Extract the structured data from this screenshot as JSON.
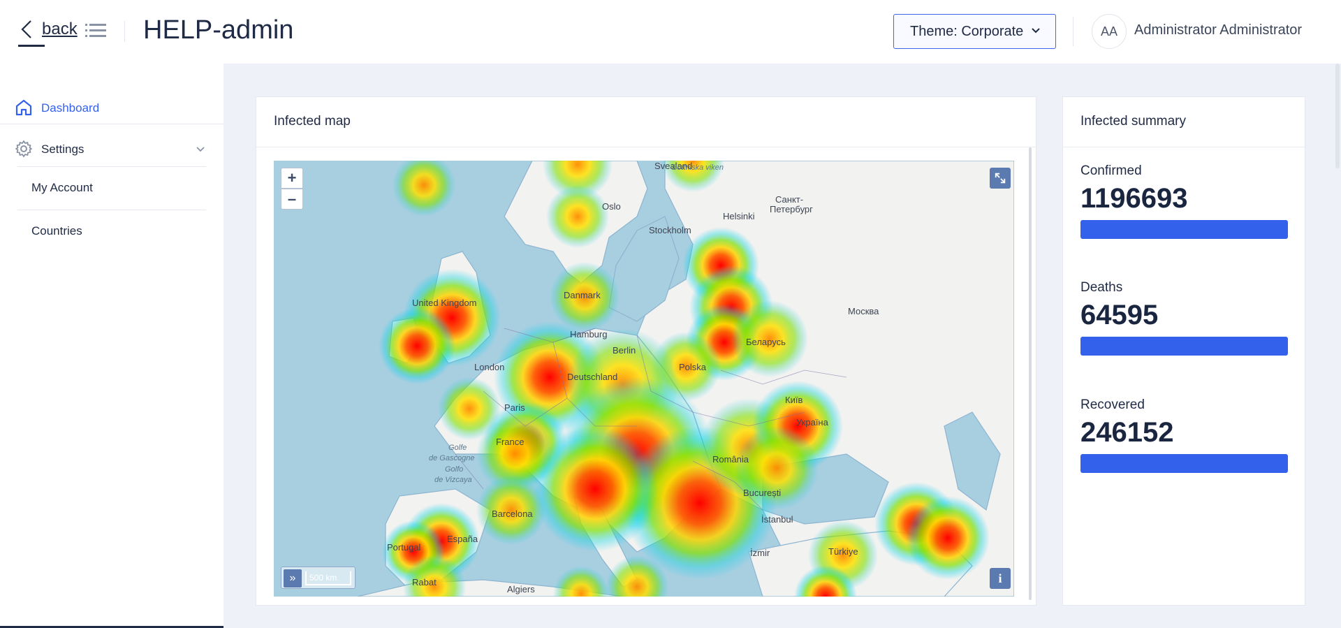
{
  "header": {
    "back_label": "back",
    "app_title": "HELP-admin",
    "theme_select": "Theme: Corporate",
    "avatar_initials": "AA",
    "user_name": "Administrator Administrator"
  },
  "sidebar": {
    "items": [
      {
        "label": "Dashboard",
        "icon": "home-icon",
        "active": true
      },
      {
        "label": "Settings",
        "icon": "gear-icon",
        "expanded": true
      }
    ],
    "sub_items": [
      {
        "label": "My Account"
      },
      {
        "label": "Countries"
      }
    ]
  },
  "map_card": {
    "title": "Infected map",
    "zoom_in": "+",
    "zoom_out": "–",
    "scale": "500 km",
    "scale_toggle": "»",
    "info": "i",
    "labels": [
      {
        "text": "Oslo",
        "kind": "city"
      },
      {
        "text": "Stockholm",
        "kind": "city"
      },
      {
        "text": "Helsinki",
        "kind": "city"
      },
      {
        "text": "Санкт-",
        "kind": "city"
      },
      {
        "text": "Петербург",
        "kind": "city"
      },
      {
        "text": "Москва",
        "kind": "city"
      },
      {
        "text": "United Kingdom",
        "kind": "country"
      },
      {
        "text": "Danmark",
        "kind": "country"
      },
      {
        "text": "Hamburg",
        "kind": "city"
      },
      {
        "text": "Berlin",
        "kind": "city"
      },
      {
        "text": "London",
        "kind": "city"
      },
      {
        "text": "Deutschland",
        "kind": "country"
      },
      {
        "text": "Polska",
        "kind": "country"
      },
      {
        "text": "Беларусь",
        "kind": "country"
      },
      {
        "text": "Paris",
        "kind": "city"
      },
      {
        "text": "France",
        "kind": "country"
      },
      {
        "text": "Київ",
        "kind": "city"
      },
      {
        "text": "Україна",
        "kind": "country"
      },
      {
        "text": "Golfe",
        "kind": "sea"
      },
      {
        "text": "de Gascogne",
        "kind": "sea"
      },
      {
        "text": "Golfo",
        "kind": "sea"
      },
      {
        "text": "de Vizcaya",
        "kind": "sea"
      },
      {
        "text": "Barcelona",
        "kind": "city"
      },
      {
        "text": "España",
        "kind": "country"
      },
      {
        "text": "Portugal",
        "kind": "country"
      },
      {
        "text": "România",
        "kind": "country"
      },
      {
        "text": "București",
        "kind": "city"
      },
      {
        "text": "İstanbul",
        "kind": "city"
      },
      {
        "text": "İzmir",
        "kind": "city"
      },
      {
        "text": "Türkiye",
        "kind": "country"
      },
      {
        "text": "Algiers",
        "kind": "city"
      },
      {
        "text": "Rabat",
        "kind": "city"
      },
      {
        "text": "Svealand",
        "kind": "country"
      },
      {
        "text": "Bottniska viken",
        "kind": "sea"
      }
    ]
  },
  "summary_card": {
    "title": "Infected summary",
    "stats": [
      {
        "label": "Confirmed",
        "value": "1196693",
        "fraction": 1.0
      },
      {
        "label": "Deaths",
        "value": "64595",
        "fraction": 1.0
      },
      {
        "label": "Recovered",
        "value": "246152",
        "fraction": 1.0
      }
    ]
  },
  "colors": {
    "accent": "#3461ec",
    "text": "#1f2a44",
    "background": "#eef1f8",
    "map_sea": "#a8cfe0",
    "map_land": "#f2f2f0"
  }
}
